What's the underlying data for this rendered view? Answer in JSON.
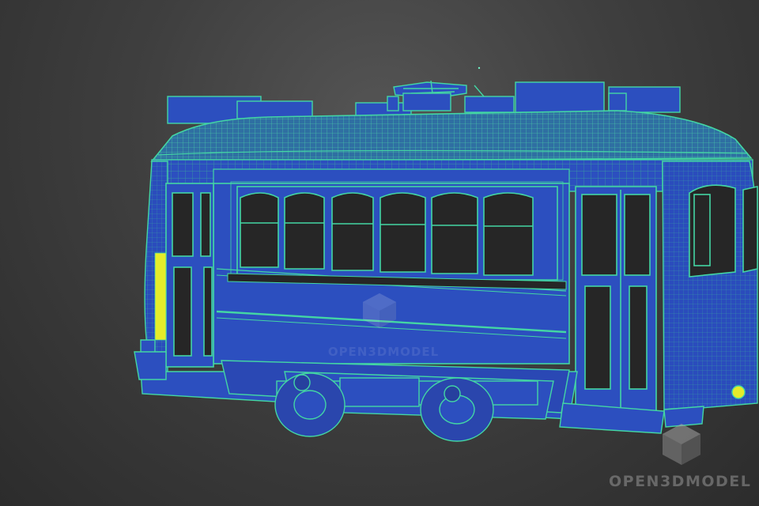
{
  "viewport": {
    "label": "3D wireframe viewport",
    "model": "tram",
    "colors": {
      "background": "#3c3c3c",
      "body": "#2c4fbf",
      "wire": "#43d6a4",
      "accent": "#e5ec2a",
      "glass": "#252525"
    }
  },
  "watermark": {
    "text": "OPEN3DMODEL",
    "center_text": "OPEN3DMODEL",
    "icon": "cube-logo-icon"
  }
}
